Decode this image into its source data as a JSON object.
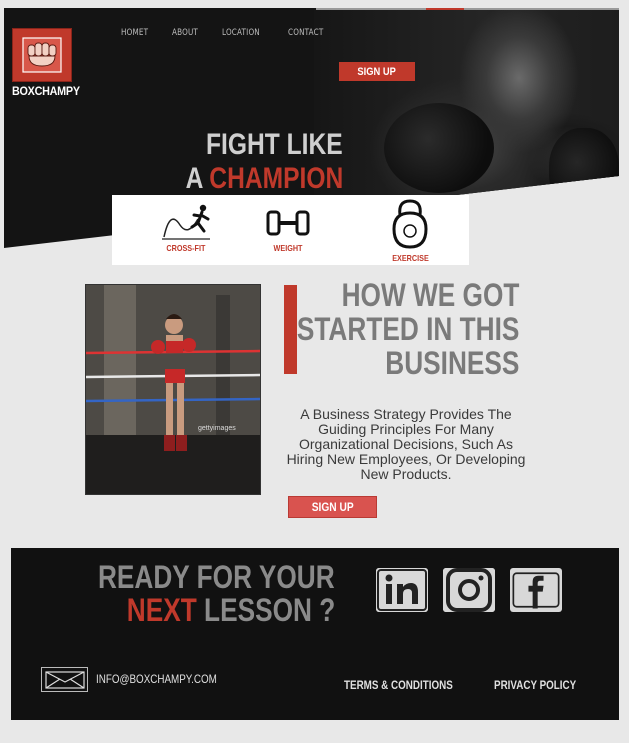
{
  "brand": {
    "name": "BOXCHAMPY",
    "accent_color": "#c0392b"
  },
  "nav": {
    "items": [
      {
        "label": "HOMET"
      },
      {
        "label": "ABOUT"
      },
      {
        "label": "LOCATION"
      },
      {
        "label": "CONTACT"
      }
    ]
  },
  "hero": {
    "signup_label": "SIGN UP",
    "title_line1": "FIGHT LIKE",
    "title_line2_prefix": "A",
    "title_line2_highlight": "CHAMPION"
  },
  "features": [
    {
      "label": "CROSS-FIT",
      "icon": "crossfit-icon"
    },
    {
      "label": "WEIGHT",
      "icon": "dumbbell-icon"
    },
    {
      "label": "EXERCISE",
      "icon": "kettlebell-icon"
    }
  ],
  "story": {
    "title_line1": "HOW WE GOT",
    "title_line2": "STARTED IN THIS",
    "title_line3": "BUSINESS",
    "body": "A Business Strategy Provides The Guiding Principles For Many Organizational Decisions, Such As Hiring New Employees, Or Developing New Products.",
    "signup_label": "SIGN UP",
    "photo_watermark": "gettyimages"
  },
  "footer": {
    "title_line1": "READY FOR YOUR",
    "title_line2_highlight": "NEXT",
    "title_line2_rest": "LESSON ?",
    "email": "INFO@BOXCHAMPY.COM",
    "terms_label": "TERMS & CONDITIONS",
    "privacy_label": "PRIVACY POLICY",
    "social": [
      {
        "icon": "linkedin-icon",
        "text": "in"
      },
      {
        "icon": "instagram-icon",
        "text": ""
      },
      {
        "icon": "facebook-icon",
        "text": "f"
      }
    ]
  }
}
